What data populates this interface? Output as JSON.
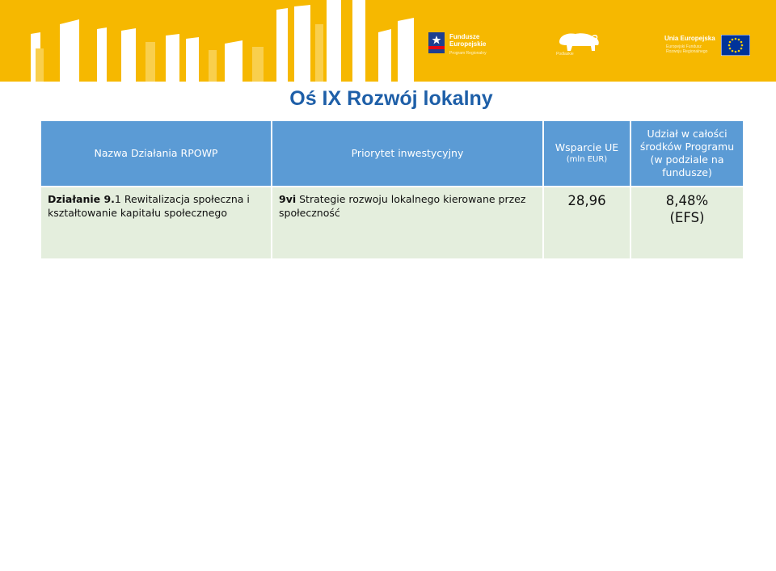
{
  "header": {
    "logos": {
      "funds": {
        "name_line1": "Fundusze",
        "name_line2": "Europejskie",
        "sub": "Program Regionalny"
      },
      "region": {
        "sub": "Podlaskie"
      },
      "eu": {
        "name": "Unia Europejska",
        "sub_line1": "Europejski Fundusz",
        "sub_line2": "Rozwoju Regionalnego"
      }
    },
    "colors": {
      "banner": "#f6b800",
      "title": "#1e5fa8",
      "table_header": "#5b9bd5",
      "table_row": "#e4eedd"
    }
  },
  "title": "Oś IX Rozwój lokalny",
  "table": {
    "headers": {
      "action": "Nazwa Działania RPOWP",
      "priority": "Priorytet  inwestycyjny",
      "support": "Wsparcie UE",
      "support_unit": "(mln EUR)",
      "share": "Udział w całości środków Programu (w podziale na fundusze)"
    },
    "rows": [
      {
        "action_bold": "Działanie 9.",
        "action_text": "1 Rewitalizacja społeczna i kształtowanie kapitału społecznego",
        "priority_bold": "9vi",
        "priority_text": " Strategie rozwoju lokalnego kierowane przez społeczność",
        "support": "28,96",
        "share": "8,48%",
        "share_fund": "(EFS)"
      }
    ]
  }
}
